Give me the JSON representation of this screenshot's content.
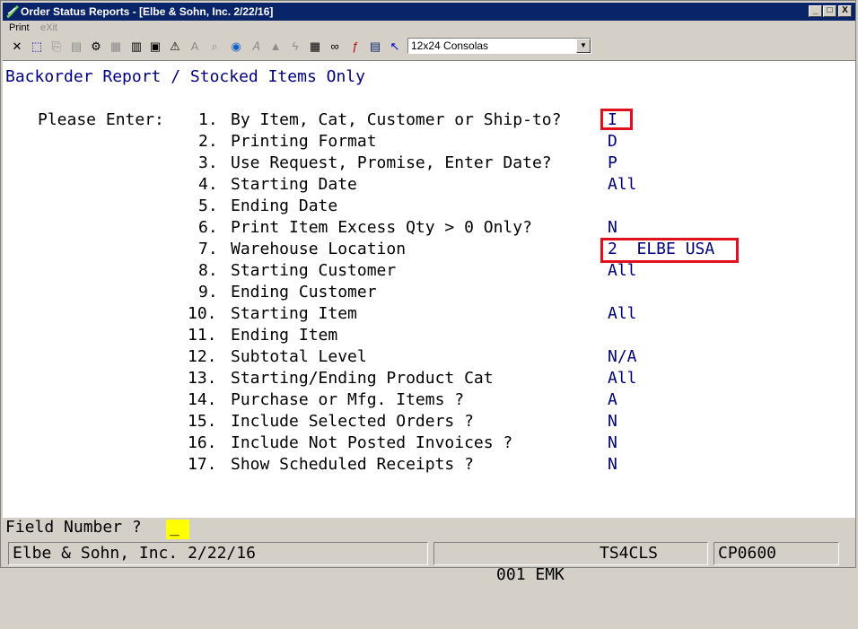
{
  "window": {
    "title": "Order Status Reports - [Elbe & Sohn, Inc. 2/22/16]",
    "controls": {
      "minimize": "_",
      "maximize": "□",
      "close": "X"
    }
  },
  "menu": {
    "items": [
      "Print",
      "eXit"
    ]
  },
  "toolbar": {
    "font_select": "12x24 Consolas",
    "icons": [
      "close-icon",
      "select-icon",
      "copy-icon",
      "paste-icon",
      "settings-icon",
      "properties-icon",
      "document-icon",
      "print-preview-icon",
      "alert-icon",
      "text-icon",
      "find-icon",
      "browser-icon",
      "font-icon",
      "stamp-icon",
      "flash-icon",
      "calculator-icon",
      "link-icon",
      "function-icon",
      "notes-icon",
      "help-pointer-icon"
    ]
  },
  "screen": {
    "heading": "Backorder Report / Stocked Items Only",
    "prompt_label": "Please Enter:",
    "fields": [
      {
        "num": "1.",
        "label": "By Item, Cat, Customer or Ship-to?",
        "value": "I"
      },
      {
        "num": "2.",
        "label": "Printing Format",
        "value": "D"
      },
      {
        "num": "3.",
        "label": "Use Request, Promise, Enter Date?",
        "value": "P"
      },
      {
        "num": "4.",
        "label": "Starting Date",
        "value": "All"
      },
      {
        "num": "5.",
        "label": "Ending Date",
        "value": ""
      },
      {
        "num": "6.",
        "label": "Print Item Excess Qty > 0 Only?",
        "value": "N"
      },
      {
        "num": "7.",
        "label": "Warehouse Location",
        "value": "2  ELBE USA"
      },
      {
        "num": "8.",
        "label": "Starting Customer",
        "value": "All"
      },
      {
        "num": "9.",
        "label": "Ending Customer",
        "value": ""
      },
      {
        "num": "10.",
        "label": "Starting Item",
        "value": "All"
      },
      {
        "num": "11.",
        "label": "Ending Item",
        "value": ""
      },
      {
        "num": "12.",
        "label": "Subtotal Level",
        "value": "N/A"
      },
      {
        "num": "13.",
        "label": "Starting/Ending Product Cat",
        "value": "All"
      },
      {
        "num": "14.",
        "label": "Purchase or Mfg. Items ?",
        "value": "A"
      },
      {
        "num": "15.",
        "label": "Include Selected Orders ?",
        "value": "N"
      },
      {
        "num": "16.",
        "label": "Include Not Posted Invoices ?",
        "value": "N"
      },
      {
        "num": "17.",
        "label": "Show Scheduled Receipts ?",
        "value": "N"
      }
    ]
  },
  "prompt": {
    "label": "Field Number ?",
    "cursor": "_"
  },
  "status": {
    "company": "Elbe & Sohn, Inc. 2/22/16",
    "user": "001 EMK",
    "terminal": "TS4CLS",
    "program": "CP0600"
  },
  "colors": {
    "title_bar": "#0a246a",
    "value_text": "#000080",
    "highlight": "#e2101c",
    "cursor": "#ffff00"
  }
}
